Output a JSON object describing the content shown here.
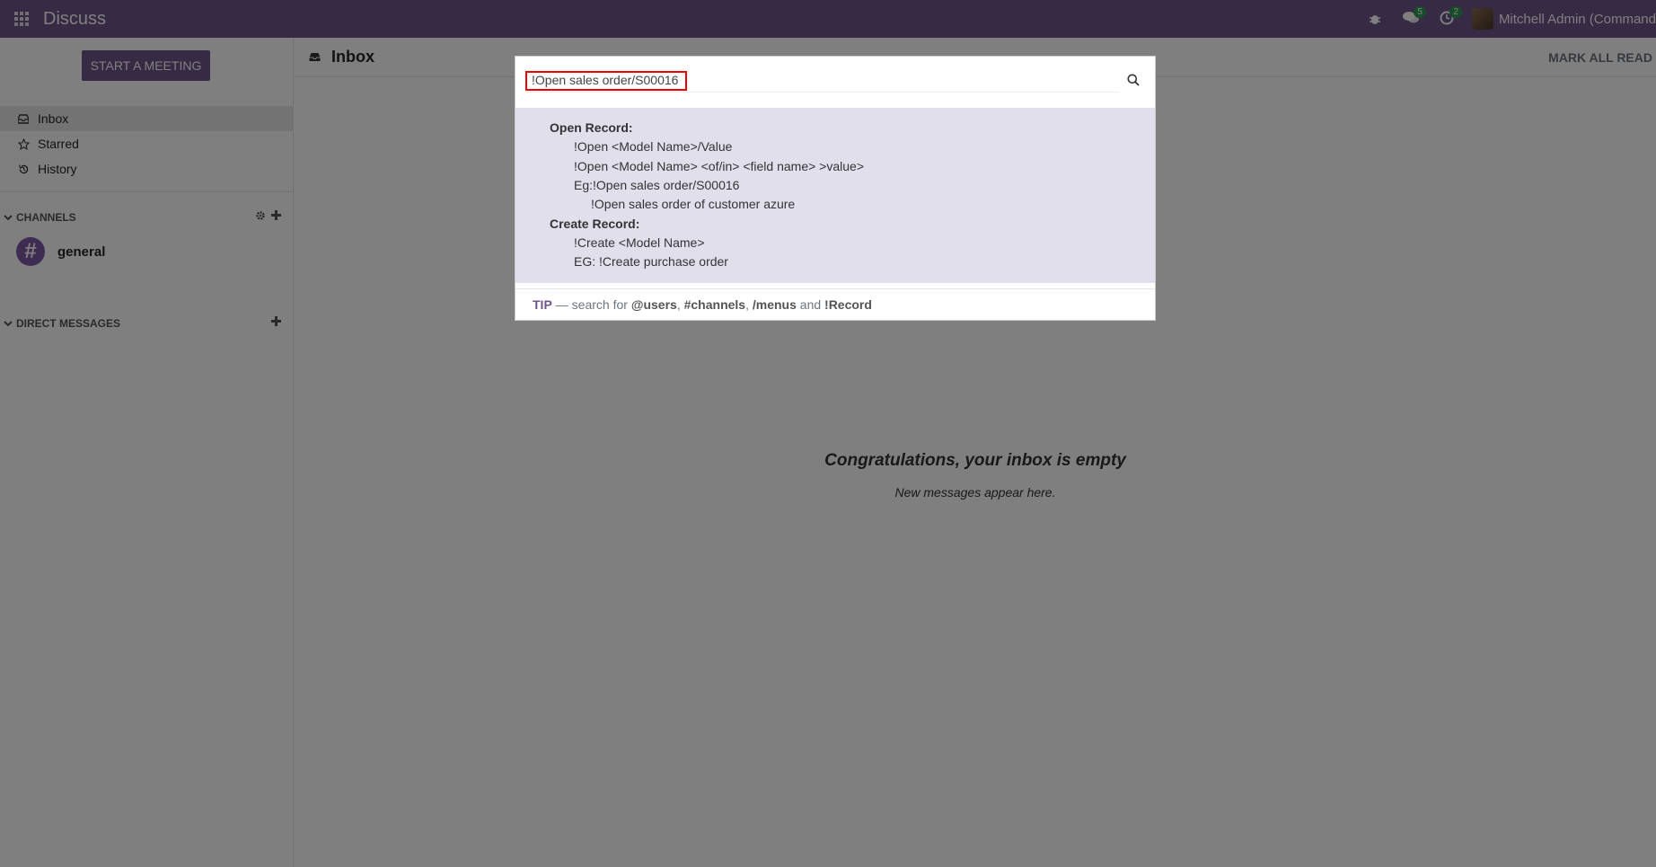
{
  "navbar": {
    "app_title": "Discuss",
    "messages_badge": "5",
    "activities_badge": "2",
    "user_name": "Mitchell Admin (Command"
  },
  "sidebar": {
    "start_meeting": "START A MEETING",
    "items": [
      {
        "label": "Inbox",
        "icon": "inbox-icon"
      },
      {
        "label": "Starred",
        "icon": "star-icon"
      },
      {
        "label": "History",
        "icon": "history-icon"
      }
    ],
    "channels_header": "CHANNELS",
    "channels": [
      {
        "label": "general"
      }
    ],
    "direct_messages_header": "DIRECT MESSAGES"
  },
  "main": {
    "title": "Inbox",
    "mark_all_read": "MARK ALL READ",
    "empty_title": "Congratulations, your inbox is empty",
    "empty_subtitle": "New messages appear here."
  },
  "palette": {
    "search_value": "!Open sales order/S00016",
    "help": {
      "open_header": "Open Record:",
      "open_line1": "!Open <Model Name>/Value",
      "open_line2": "!Open <Model Name> <of/in> <field name> >value>",
      "open_eg1": "Eg:!Open sales order/S00016",
      "open_eg2": "!Open sales order of customer azure",
      "create_header": "Create Record:",
      "create_line1": "!Create <Model Name>",
      "create_eg": "EG: !Create purchase order"
    },
    "tip": {
      "label": "TIP",
      "prefix": "— search for",
      "users": "@users",
      "sep1": ",",
      "channels": "#channels",
      "sep2": ",",
      "menus": "/menus",
      "and": "and",
      "record": "!Record"
    }
  }
}
